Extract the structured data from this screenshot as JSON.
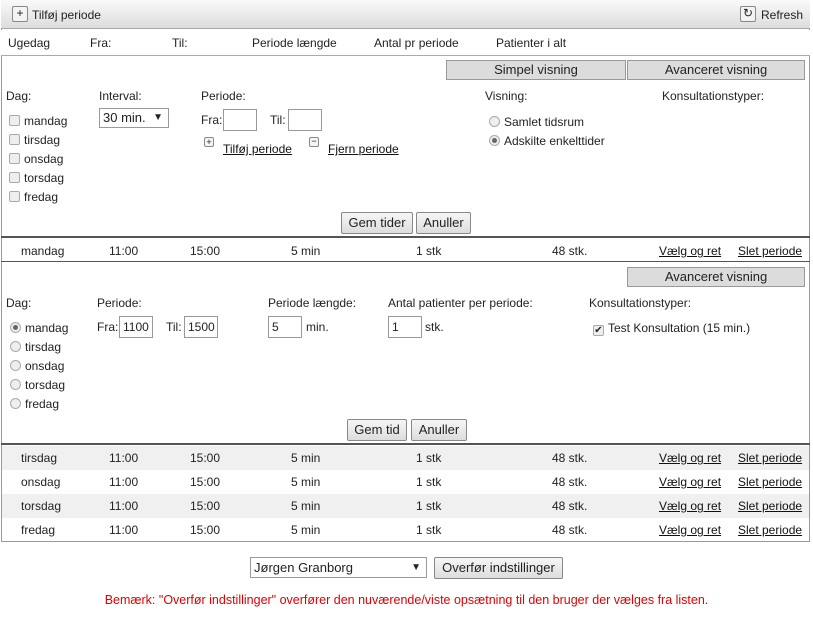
{
  "toolbar": {
    "add_label": "Tilføj periode",
    "refresh_label": "Refresh"
  },
  "header": {
    "cols": [
      "Ugedag",
      "Fra:",
      "Til:",
      "Periode længde",
      "Antal pr periode",
      "Patienter i alt"
    ]
  },
  "panel1": {
    "simple_view": "Simpel visning",
    "advanced_view": "Avanceret visning",
    "dag_label": "Dag:",
    "days": [
      "mandag",
      "tirsdag",
      "onsdag",
      "torsdag",
      "fredag"
    ],
    "interval_label": "Interval:",
    "interval_value": "30 min.",
    "periode_label": "Periode:",
    "fra_label": "Fra:",
    "til_label": "Til:",
    "fra_value": "",
    "til_value": "",
    "add_period": "Tilføj periode",
    "remove_period": "Fjern periode",
    "visning_label": "Visning:",
    "visning_options": [
      "Samlet tidsrum",
      "Adskilte enkelttider"
    ],
    "visning_selected": "Adskilte enkelttider",
    "konsult_label": "Konsultationstyper:",
    "save": "Gem tider",
    "cancel": "Anuller"
  },
  "panel2": {
    "advanced_view": "Avanceret visning",
    "dag_label": "Dag:",
    "days": [
      "mandag",
      "tirsdag",
      "onsdag",
      "torsdag",
      "fredag"
    ],
    "selected_day": "mandag",
    "periode_label": "Periode:",
    "fra_label": "Fra:",
    "fra_value": "1100",
    "til_label": "Til:",
    "til_value": "1500",
    "length_label": "Periode længde:",
    "length_value": "5",
    "length_unit": "min.",
    "antal_label": "Antal patienter per periode:",
    "antal_value": "1",
    "antal_unit": "stk.",
    "konsult_label": "Konsultationstyper:",
    "konsult_item": "Test Konsultation (15 min.)",
    "konsult_checked": true,
    "save": "Gem tid",
    "cancel": "Anuller"
  },
  "rows": [
    {
      "day": "mandag",
      "fra": "11:00",
      "til": "15:00",
      "length": "5 min",
      "antal": "1 stk",
      "total": "48 stk.",
      "edit": "Vælg og ret",
      "delete": "Slet periode"
    },
    {
      "day": "tirsdag",
      "fra": "11:00",
      "til": "15:00",
      "length": "5 min",
      "antal": "1 stk",
      "total": "48 stk.",
      "edit": "Vælg og ret",
      "delete": "Slet periode"
    },
    {
      "day": "onsdag",
      "fra": "11:00",
      "til": "15:00",
      "length": "5 min",
      "antal": "1 stk",
      "total": "48 stk.",
      "edit": "Vælg og ret",
      "delete": "Slet periode"
    },
    {
      "day": "torsdag",
      "fra": "11:00",
      "til": "15:00",
      "length": "5 min",
      "antal": "1 stk",
      "total": "48 stk.",
      "edit": "Vælg og ret",
      "delete": "Slet periode"
    },
    {
      "day": "fredag",
      "fra": "11:00",
      "til": "15:00",
      "length": "5 min",
      "antal": "1 stk",
      "total": "48 stk.",
      "edit": "Vælg og ret",
      "delete": "Slet periode"
    }
  ],
  "footer": {
    "user_select": "Jørgen Granborg",
    "transfer": "Overfør indstillinger",
    "note": "Bemærk: \"Overfør indstillinger\" overfører den nuværende/viste opsætning til den bruger der vælges fra listen.",
    "note_color": "#e00000"
  }
}
